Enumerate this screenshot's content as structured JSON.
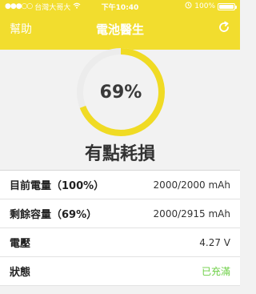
{
  "statusbar": {
    "carrier": "台灣大哥大",
    "time": "下午10:40",
    "battery_percent": "100%",
    "battery_level": 1.0
  },
  "nav": {
    "left": "幫助",
    "title": "電池醫生",
    "refresh_icon": "refresh-icon"
  },
  "gauge": {
    "value_text": "69%",
    "percent": 69,
    "track_color": "#ececec",
    "fill_color": "#f0db24"
  },
  "status_label": "有點耗損",
  "rows": [
    {
      "label": "目前電量（100%）",
      "value": "2000/2000 mAh",
      "accent": false
    },
    {
      "label": "剩餘容量（69%）",
      "value": "2000/2915 mAh",
      "accent": false
    },
    {
      "label": "電壓",
      "value": "4.27 V",
      "accent": false
    },
    {
      "label": "狀態",
      "value": "已充滿",
      "accent": true
    }
  ],
  "colors": {
    "brand_yellow": "#f2dd2e",
    "status_green": "#6ccf45"
  }
}
